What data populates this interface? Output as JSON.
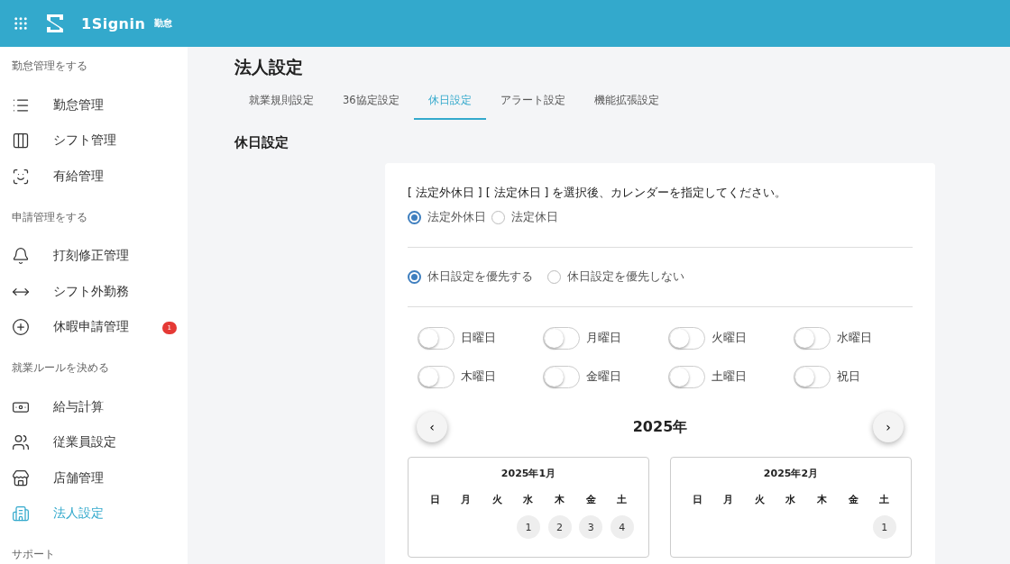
{
  "header": {
    "brand": "1Signin",
    "product": "勤怠"
  },
  "sidebar": {
    "sections": [
      {
        "heading": "勤怠管理をする",
        "items": [
          {
            "label": "勤怠管理",
            "selected": false
          },
          {
            "label": "シフト管理",
            "selected": false
          },
          {
            "label": "有給管理",
            "selected": false
          }
        ]
      },
      {
        "heading": "申請管理をする",
        "items": [
          {
            "label": "打刻修正管理",
            "selected": false
          },
          {
            "label": "シフト外勤務",
            "selected": false
          },
          {
            "label": "休暇申請管理",
            "selected": false,
            "badge": "1"
          }
        ]
      },
      {
        "heading": "就業ルールを決める",
        "items": [
          {
            "label": "給与計算",
            "selected": false
          },
          {
            "label": "従業員設定",
            "selected": false
          },
          {
            "label": "店舗管理",
            "selected": false
          },
          {
            "label": "法人設定",
            "selected": true
          }
        ]
      },
      {
        "heading": "サポート"
      }
    ]
  },
  "page": {
    "title": "法人設定",
    "tabs": [
      {
        "label": "就業規則設定",
        "selected": false
      },
      {
        "label": "36協定設定",
        "selected": false
      },
      {
        "label": "休日設定",
        "selected": true
      },
      {
        "label": "アラート設定",
        "selected": false
      },
      {
        "label": "機能拡張設定",
        "selected": false
      }
    ],
    "section_title": "休日設定",
    "instruction": "[ 法定外休日 ] [ 法定休日 ] を選択後、カレンダーを指定してください。",
    "holiday_type": [
      {
        "label": "法定外休日",
        "selected": true
      },
      {
        "label": "法定休日",
        "selected": false
      }
    ],
    "priority": [
      {
        "label": "休日設定を優先する",
        "selected": true
      },
      {
        "label": "休日設定を優先しない",
        "selected": false
      }
    ],
    "weekday_toggles": [
      {
        "label": "日曜日",
        "on": false
      },
      {
        "label": "月曜日",
        "on": false
      },
      {
        "label": "火曜日",
        "on": false
      },
      {
        "label": "水曜日",
        "on": false
      },
      {
        "label": "木曜日",
        "on": false
      },
      {
        "label": "金曜日",
        "on": false
      },
      {
        "label": "土曜日",
        "on": false
      },
      {
        "label": "祝日",
        "on": false
      }
    ],
    "year_nav": {
      "prev": "‹",
      "year": "2025年",
      "next": "›"
    },
    "months": [
      {
        "title": "2025年1月",
        "weekdays": [
          "日",
          "月",
          "火",
          "水",
          "木",
          "金",
          "土"
        ],
        "weeks": [
          [
            "1",
            "2",
            "3",
            "4"
          ]
        ]
      },
      {
        "title": "2025年2月",
        "weekdays": [
          "日",
          "月",
          "火",
          "水",
          "木",
          "金",
          "土"
        ],
        "weeks": [
          [
            "1"
          ]
        ]
      }
    ]
  }
}
